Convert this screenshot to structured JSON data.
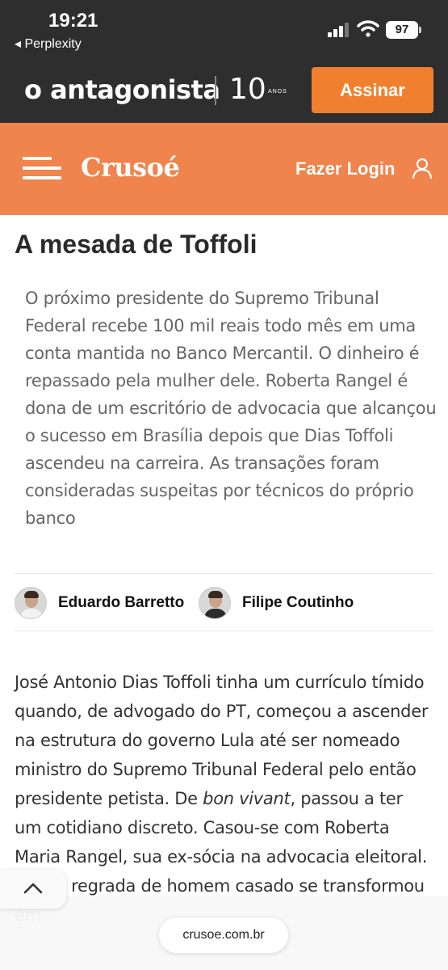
{
  "status": {
    "time": "19:21",
    "back_app": "◂ Perplexity",
    "battery": "97"
  },
  "header": {
    "logo": "o antagonista",
    "anniversary_number": "10",
    "anniversary_label": "ANOS",
    "subscribe_label": "Assinar"
  },
  "nav": {
    "brand": "Crusoé",
    "login_label": "Fazer Login"
  },
  "article": {
    "title": "A mesada de Toffoli",
    "lede": "O próximo presidente do Supremo Tribunal Federal recebe 100 mil reais todo mês em uma conta mantida no Banco Mercantil. O dinheiro é repassado pela mulher dele. Roberta Rangel é dona de um escritório de advocacia que alcançou o sucesso em Brasília depois que Dias Toffoli ascendeu na carreira. As transações foram consideradas suspeitas por técnicos do próprio banco",
    "authors": [
      {
        "name": "Eduardo Barretto"
      },
      {
        "name": "Filipe Coutinho"
      }
    ],
    "body_before_italic": "José Antonio Dias Toffoli tinha um currículo tímido quando, de advogado do PT, começou a ascender na estrutura do governo Lula até ser nomeado ministro do Supremo Tribunal Federal pelo então presidente petista. De ",
    "body_italic": "bon vivant",
    "body_after_italic": ", passou a ter um cotidiano discreto. Casou-se com Roberta Maria Rangel, sua ex-sócia na advocacia eleitoral. A vida regrada de homem casado se transformou em"
  },
  "browser": {
    "url": "crusoe.com.br"
  }
}
